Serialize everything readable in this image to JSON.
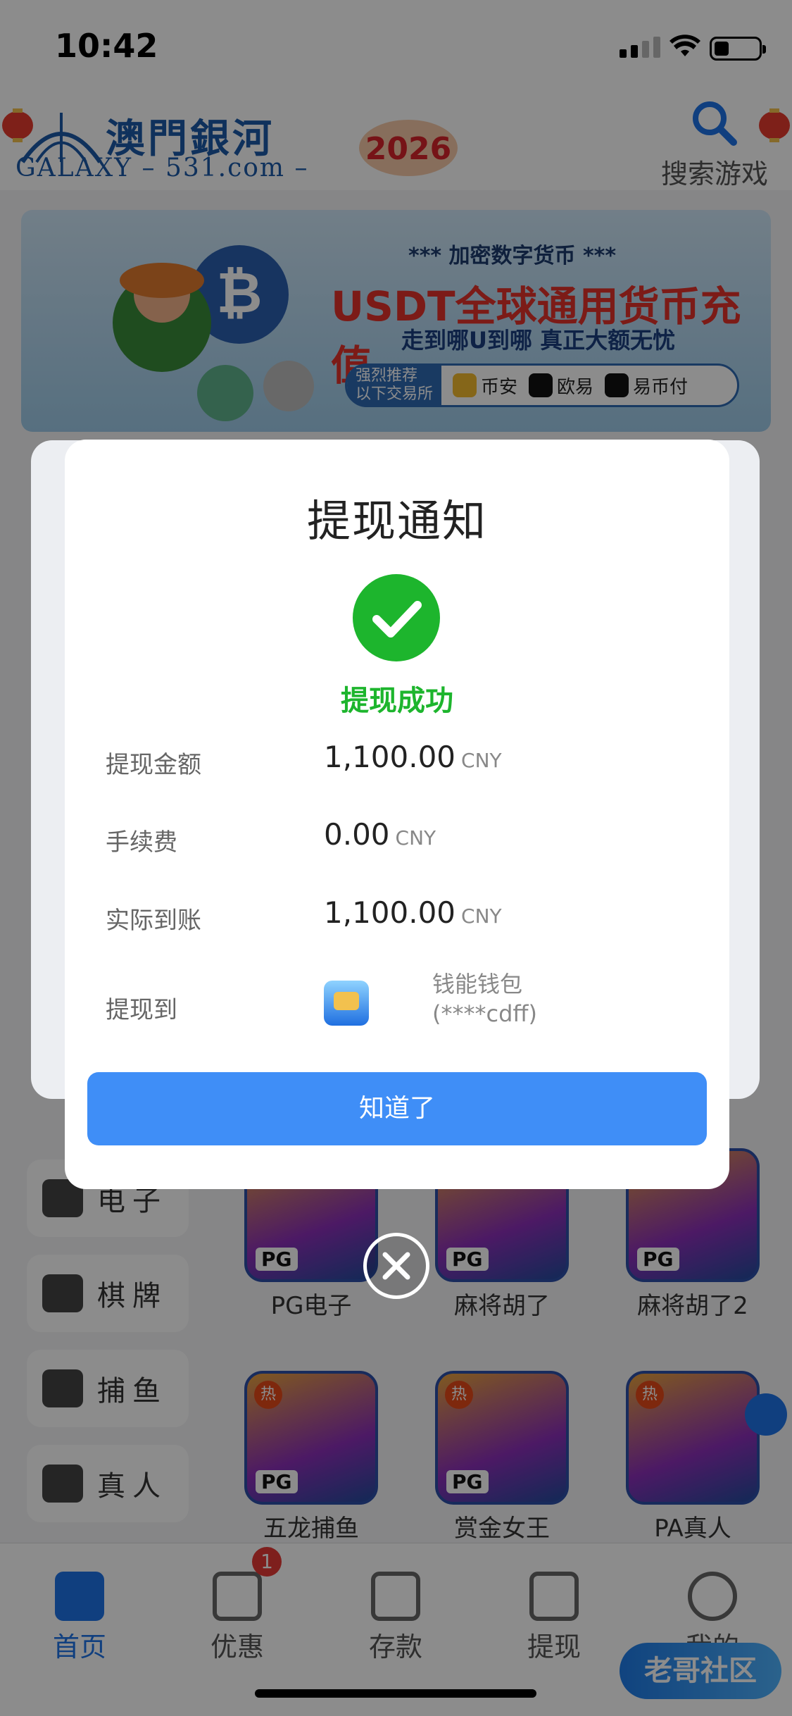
{
  "status_bar": {
    "time": "10:42"
  },
  "header": {
    "logo_text": "澳門銀河",
    "logo_sub": "GALAXY – 531.com –",
    "search_label": "搜索游戏",
    "year_badge": "2026"
  },
  "banner": {
    "line1": "*** 加密数字货币 ***",
    "line2": "USDT全球通用货币充值",
    "line3": "走到哪U到哪 真正大额无忧",
    "tag": "强烈推荐\n以下交易所",
    "exchanges": [
      "币安",
      "欧易",
      "易币付"
    ]
  },
  "categories": [
    "电子",
    "棋牌",
    "捕鱼",
    "真人"
  ],
  "games": [
    {
      "name": "PG电子",
      "hot": false
    },
    {
      "name": "麻将胡了",
      "hot": false
    },
    {
      "name": "麻将胡了2",
      "hot": false
    },
    {
      "name": "五龙捕鱼",
      "hot": true
    },
    {
      "name": "赏金女王",
      "hot": true
    },
    {
      "name": "PA真人",
      "hot": true
    }
  ],
  "game_badges": {
    "hot": "热",
    "pg": "PG"
  },
  "tabbar": {
    "items": [
      "首页",
      "优惠",
      "存款",
      "提现",
      "我的"
    ],
    "active": "首页",
    "promo_badge": "1"
  },
  "watermark": "老哥社区",
  "modal": {
    "title": "提现通知",
    "status": "提现成功",
    "rows": [
      {
        "label": "提现金额",
        "value": "1,100.00",
        "currency": "CNY"
      },
      {
        "label": "手续费",
        "value": "0.00",
        "currency": "CNY"
      },
      {
        "label": "实际到账",
        "value": "1,100.00",
        "currency": "CNY"
      }
    ],
    "destination_label": "提现到",
    "wallet_name": "钱能钱包",
    "wallet_account": "(****cdff)",
    "confirm_label": "知道了"
  },
  "colors": {
    "success": "#1db52d",
    "primary": "#3f8ef7",
    "brand": "#1d5aa8"
  }
}
